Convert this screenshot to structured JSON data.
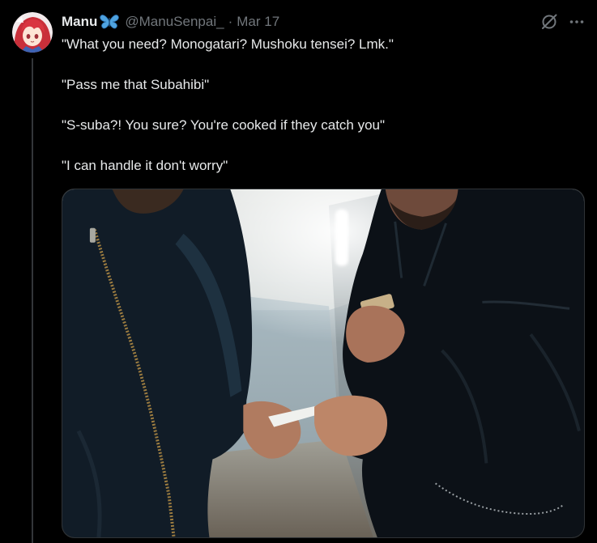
{
  "theme": {
    "background": "#000000",
    "text": "#e7e9ea",
    "muted": "#71767b",
    "thread_line": "#333639",
    "border": "#2f3336",
    "name_emoji_color": "#4fa3e0"
  },
  "tweet": {
    "author": {
      "name": "Manu",
      "name_emoji_icon": "butterfly-icon",
      "handle": "@ManuSenpai_",
      "separator": "·",
      "date": "Mar 17"
    },
    "header_actions": [
      {
        "icon": "grok-icon"
      },
      {
        "icon": "more-icon"
      }
    ],
    "text_lines": [
      "\"What you need? Monogatari? Mushoku tensei? Lmk.\"",
      "\"Pass me that Subahibi\"",
      "\"S-suba?! You sure? You're cooked if they catch you\"",
      "\"I can handle it don't worry\""
    ]
  }
}
